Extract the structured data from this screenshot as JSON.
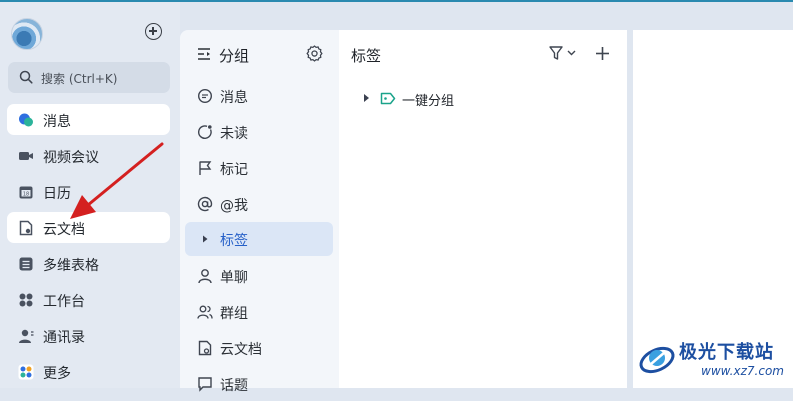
{
  "sidebar": {
    "search_placeholder": "搜索 (Ctrl+K)",
    "items": [
      {
        "label": "消息",
        "icon": "chat-bubble-icon"
      },
      {
        "label": "视频会议",
        "icon": "video-camera-icon"
      },
      {
        "label": "日历",
        "icon": "calendar-icon"
      },
      {
        "label": "云文档",
        "icon": "cloud-doc-icon"
      },
      {
        "label": "多维表格",
        "icon": "table-icon"
      },
      {
        "label": "工作台",
        "icon": "grid-apps-icon"
      },
      {
        "label": "通讯录",
        "icon": "contacts-icon"
      },
      {
        "label": "更多",
        "icon": "more-apps-icon"
      }
    ]
  },
  "groups_panel": {
    "title": "分组",
    "items": [
      {
        "label": "消息"
      },
      {
        "label": "未读"
      },
      {
        "label": "标记"
      },
      {
        "label": "@我"
      },
      {
        "label": "标签"
      },
      {
        "label": "单聊"
      },
      {
        "label": "群组"
      },
      {
        "label": "云文档"
      },
      {
        "label": "话题"
      }
    ]
  },
  "tags_panel": {
    "title": "标签",
    "tag_item": "一键分组"
  },
  "watermark": {
    "name": "极光下载站",
    "url": "www.xz7.com"
  },
  "colors": {
    "accent": "#2660c8",
    "active_bg": "#dbe6f6",
    "annotation_arrow": "#d42020",
    "tag_green": "#1aa38a"
  }
}
